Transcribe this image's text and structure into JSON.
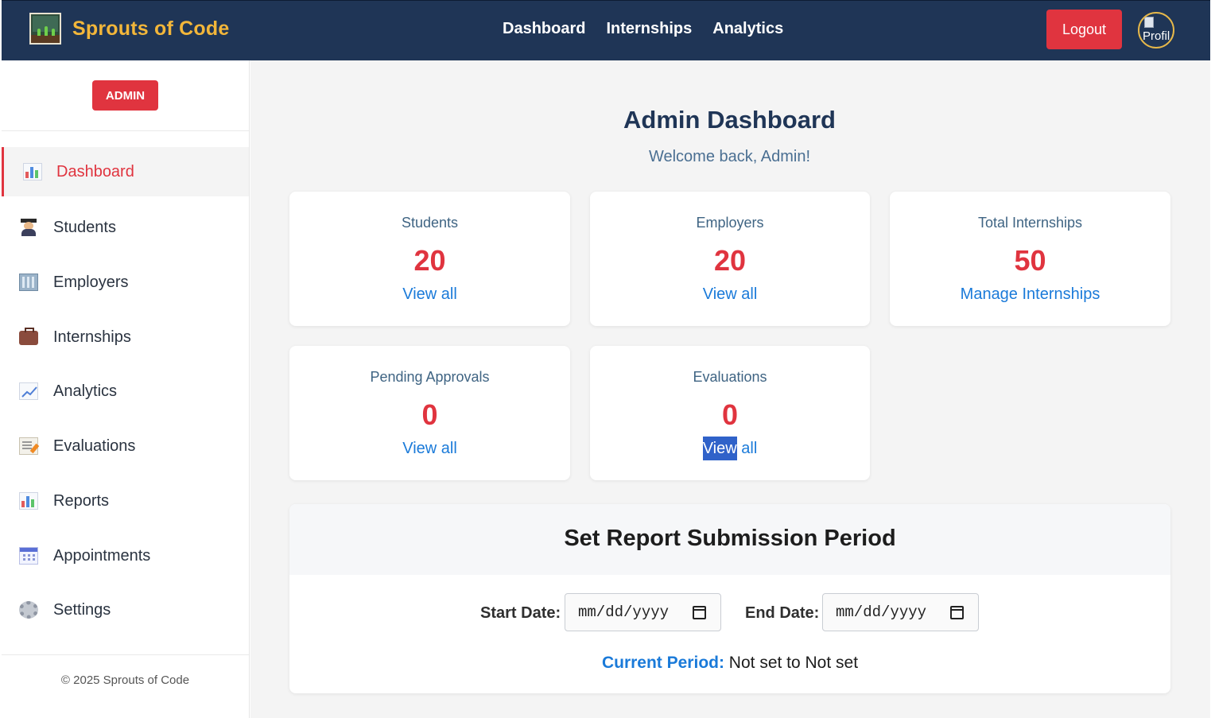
{
  "header": {
    "brand": "Sprouts of Code",
    "nav": [
      "Dashboard",
      "Internships",
      "Analytics"
    ],
    "logout_label": "Logout",
    "profile_alt": "Profil"
  },
  "sidebar": {
    "role_badge": "ADMIN",
    "items": [
      {
        "label": "Dashboard",
        "icon": "bar-chart-icon",
        "active": true
      },
      {
        "label": "Students",
        "icon": "graduate-icon"
      },
      {
        "label": "Employers",
        "icon": "building-icon"
      },
      {
        "label": "Internships",
        "icon": "briefcase-icon"
      },
      {
        "label": "Analytics",
        "icon": "line-chart-icon"
      },
      {
        "label": "Evaluations",
        "icon": "memo-icon"
      },
      {
        "label": "Reports",
        "icon": "bar-chart-icon"
      },
      {
        "label": "Appointments",
        "icon": "calendar-icon"
      },
      {
        "label": "Settings",
        "icon": "gear-icon"
      }
    ],
    "footer": "© 2025 Sprouts of Code"
  },
  "main": {
    "title": "Admin Dashboard",
    "welcome": "Welcome back, Admin!",
    "cards": [
      {
        "title": "Students",
        "value": "20",
        "link": "View all"
      },
      {
        "title": "Employers",
        "value": "20",
        "link": "View all"
      },
      {
        "title": "Total Internships",
        "value": "50",
        "link": "Manage Internships"
      },
      {
        "title": "Pending Approvals",
        "value": "0",
        "link": "View all"
      },
      {
        "title": "Evaluations",
        "value": "0",
        "link_selected": "View",
        "link_rest": " all"
      }
    ],
    "report": {
      "title": "Set Report Submission Period",
      "start_label": "Start Date:",
      "end_label": "End Date:",
      "start_placeholder": "mm/dd/yyyy",
      "end_placeholder": "mm/dd/yyyy",
      "current_label": "Current Period:",
      "current_value": " Not set to Not set"
    }
  },
  "colors": {
    "navbar": "#1f3556",
    "brand": "#f2b63a",
    "accent_red": "#e0343f",
    "link_blue": "#1a7ad9"
  }
}
